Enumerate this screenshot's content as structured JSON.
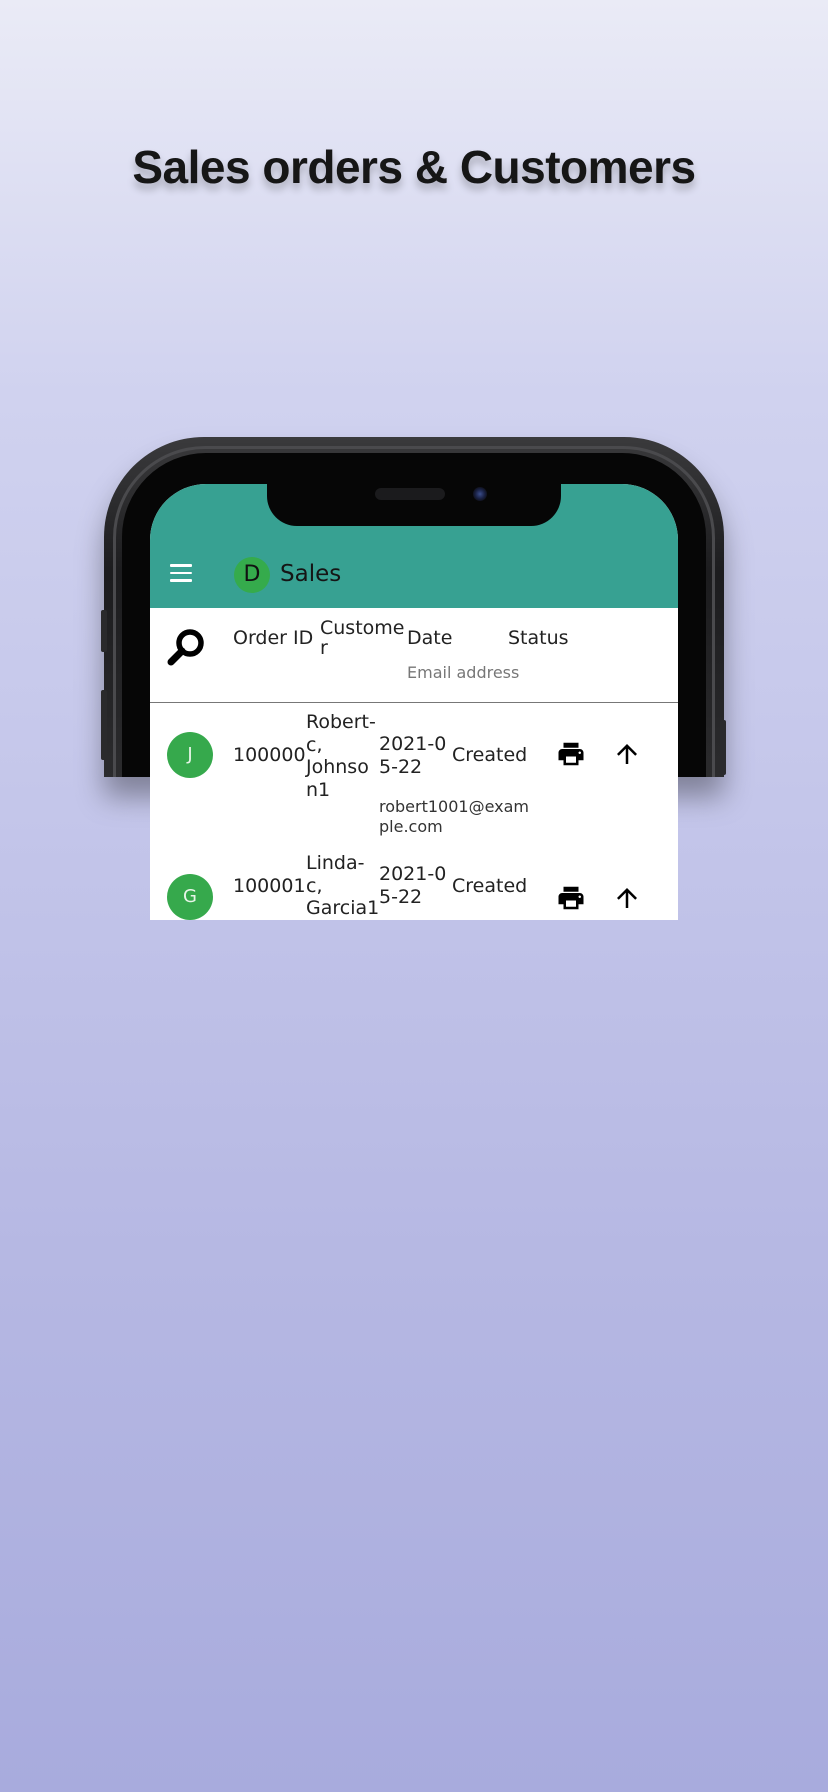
{
  "page": {
    "heading": "Sales orders & Customers"
  },
  "app": {
    "title": "Sales",
    "logo_letter": "D",
    "primary_color": "#37a192",
    "avatar_color": "#36a94c"
  },
  "table": {
    "columns": {
      "order_id": "Order ID",
      "customer": "Custome\nr",
      "date": "Date",
      "status": "Status",
      "email_subheader": "Email address"
    },
    "rows": [
      {
        "avatar": "J",
        "order_id": "100000",
        "customer": "Robert-\nc,\nJohnso\nn1",
        "date": "2021-0\n5-22",
        "status": "Created",
        "email": "robert1001@exam\nple.com"
      },
      {
        "avatar": "G",
        "order_id": "100001",
        "customer": "Linda-\nc,\nGarcia1",
        "date": "2021-0\n5-22",
        "status": "Created",
        "email": ""
      }
    ]
  },
  "icons": {
    "menu": "menu-icon",
    "search": "search-icon",
    "print": "print-icon",
    "upload": "arrow-up-icon"
  }
}
